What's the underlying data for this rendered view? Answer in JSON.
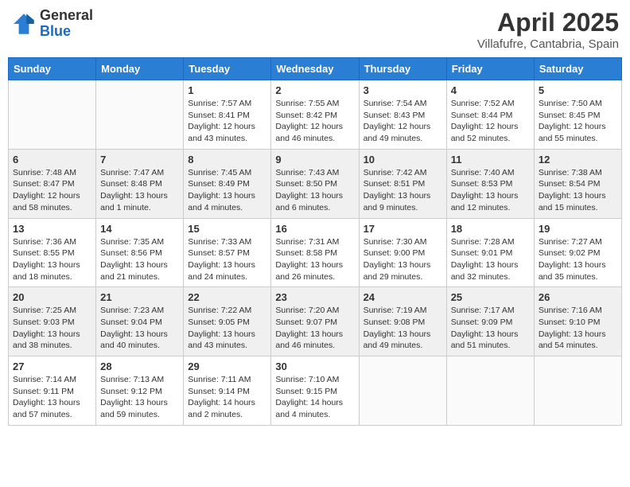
{
  "header": {
    "logo_general": "General",
    "logo_blue": "Blue",
    "title": "April 2025",
    "subtitle": "Villafufre, Cantabria, Spain"
  },
  "calendar": {
    "weekdays": [
      "Sunday",
      "Monday",
      "Tuesday",
      "Wednesday",
      "Thursday",
      "Friday",
      "Saturday"
    ],
    "weeks": [
      [
        {
          "day": "",
          "sunrise": "",
          "sunset": "",
          "daylight": ""
        },
        {
          "day": "",
          "sunrise": "",
          "sunset": "",
          "daylight": ""
        },
        {
          "day": "1",
          "sunrise": "Sunrise: 7:57 AM",
          "sunset": "Sunset: 8:41 PM",
          "daylight": "Daylight: 12 hours and 43 minutes."
        },
        {
          "day": "2",
          "sunrise": "Sunrise: 7:55 AM",
          "sunset": "Sunset: 8:42 PM",
          "daylight": "Daylight: 12 hours and 46 minutes."
        },
        {
          "day": "3",
          "sunrise": "Sunrise: 7:54 AM",
          "sunset": "Sunset: 8:43 PM",
          "daylight": "Daylight: 12 hours and 49 minutes."
        },
        {
          "day": "4",
          "sunrise": "Sunrise: 7:52 AM",
          "sunset": "Sunset: 8:44 PM",
          "daylight": "Daylight: 12 hours and 52 minutes."
        },
        {
          "day": "5",
          "sunrise": "Sunrise: 7:50 AM",
          "sunset": "Sunset: 8:45 PM",
          "daylight": "Daylight: 12 hours and 55 minutes."
        }
      ],
      [
        {
          "day": "6",
          "sunrise": "Sunrise: 7:48 AM",
          "sunset": "Sunset: 8:47 PM",
          "daylight": "Daylight: 12 hours and 58 minutes."
        },
        {
          "day": "7",
          "sunrise": "Sunrise: 7:47 AM",
          "sunset": "Sunset: 8:48 PM",
          "daylight": "Daylight: 13 hours and 1 minute."
        },
        {
          "day": "8",
          "sunrise": "Sunrise: 7:45 AM",
          "sunset": "Sunset: 8:49 PM",
          "daylight": "Daylight: 13 hours and 4 minutes."
        },
        {
          "day": "9",
          "sunrise": "Sunrise: 7:43 AM",
          "sunset": "Sunset: 8:50 PM",
          "daylight": "Daylight: 13 hours and 6 minutes."
        },
        {
          "day": "10",
          "sunrise": "Sunrise: 7:42 AM",
          "sunset": "Sunset: 8:51 PM",
          "daylight": "Daylight: 13 hours and 9 minutes."
        },
        {
          "day": "11",
          "sunrise": "Sunrise: 7:40 AM",
          "sunset": "Sunset: 8:53 PM",
          "daylight": "Daylight: 13 hours and 12 minutes."
        },
        {
          "day": "12",
          "sunrise": "Sunrise: 7:38 AM",
          "sunset": "Sunset: 8:54 PM",
          "daylight": "Daylight: 13 hours and 15 minutes."
        }
      ],
      [
        {
          "day": "13",
          "sunrise": "Sunrise: 7:36 AM",
          "sunset": "Sunset: 8:55 PM",
          "daylight": "Daylight: 13 hours and 18 minutes."
        },
        {
          "day": "14",
          "sunrise": "Sunrise: 7:35 AM",
          "sunset": "Sunset: 8:56 PM",
          "daylight": "Daylight: 13 hours and 21 minutes."
        },
        {
          "day": "15",
          "sunrise": "Sunrise: 7:33 AM",
          "sunset": "Sunset: 8:57 PM",
          "daylight": "Daylight: 13 hours and 24 minutes."
        },
        {
          "day": "16",
          "sunrise": "Sunrise: 7:31 AM",
          "sunset": "Sunset: 8:58 PM",
          "daylight": "Daylight: 13 hours and 26 minutes."
        },
        {
          "day": "17",
          "sunrise": "Sunrise: 7:30 AM",
          "sunset": "Sunset: 9:00 PM",
          "daylight": "Daylight: 13 hours and 29 minutes."
        },
        {
          "day": "18",
          "sunrise": "Sunrise: 7:28 AM",
          "sunset": "Sunset: 9:01 PM",
          "daylight": "Daylight: 13 hours and 32 minutes."
        },
        {
          "day": "19",
          "sunrise": "Sunrise: 7:27 AM",
          "sunset": "Sunset: 9:02 PM",
          "daylight": "Daylight: 13 hours and 35 minutes."
        }
      ],
      [
        {
          "day": "20",
          "sunrise": "Sunrise: 7:25 AM",
          "sunset": "Sunset: 9:03 PM",
          "daylight": "Daylight: 13 hours and 38 minutes."
        },
        {
          "day": "21",
          "sunrise": "Sunrise: 7:23 AM",
          "sunset": "Sunset: 9:04 PM",
          "daylight": "Daylight: 13 hours and 40 minutes."
        },
        {
          "day": "22",
          "sunrise": "Sunrise: 7:22 AM",
          "sunset": "Sunset: 9:05 PM",
          "daylight": "Daylight: 13 hours and 43 minutes."
        },
        {
          "day": "23",
          "sunrise": "Sunrise: 7:20 AM",
          "sunset": "Sunset: 9:07 PM",
          "daylight": "Daylight: 13 hours and 46 minutes."
        },
        {
          "day": "24",
          "sunrise": "Sunrise: 7:19 AM",
          "sunset": "Sunset: 9:08 PM",
          "daylight": "Daylight: 13 hours and 49 minutes."
        },
        {
          "day": "25",
          "sunrise": "Sunrise: 7:17 AM",
          "sunset": "Sunset: 9:09 PM",
          "daylight": "Daylight: 13 hours and 51 minutes."
        },
        {
          "day": "26",
          "sunrise": "Sunrise: 7:16 AM",
          "sunset": "Sunset: 9:10 PM",
          "daylight": "Daylight: 13 hours and 54 minutes."
        }
      ],
      [
        {
          "day": "27",
          "sunrise": "Sunrise: 7:14 AM",
          "sunset": "Sunset: 9:11 PM",
          "daylight": "Daylight: 13 hours and 57 minutes."
        },
        {
          "day": "28",
          "sunrise": "Sunrise: 7:13 AM",
          "sunset": "Sunset: 9:12 PM",
          "daylight": "Daylight: 13 hours and 59 minutes."
        },
        {
          "day": "29",
          "sunrise": "Sunrise: 7:11 AM",
          "sunset": "Sunset: 9:14 PM",
          "daylight": "Daylight: 14 hours and 2 minutes."
        },
        {
          "day": "30",
          "sunrise": "Sunrise: 7:10 AM",
          "sunset": "Sunset: 9:15 PM",
          "daylight": "Daylight: 14 hours and 4 minutes."
        },
        {
          "day": "",
          "sunrise": "",
          "sunset": "",
          "daylight": ""
        },
        {
          "day": "",
          "sunrise": "",
          "sunset": "",
          "daylight": ""
        },
        {
          "day": "",
          "sunrise": "",
          "sunset": "",
          "daylight": ""
        }
      ]
    ]
  }
}
